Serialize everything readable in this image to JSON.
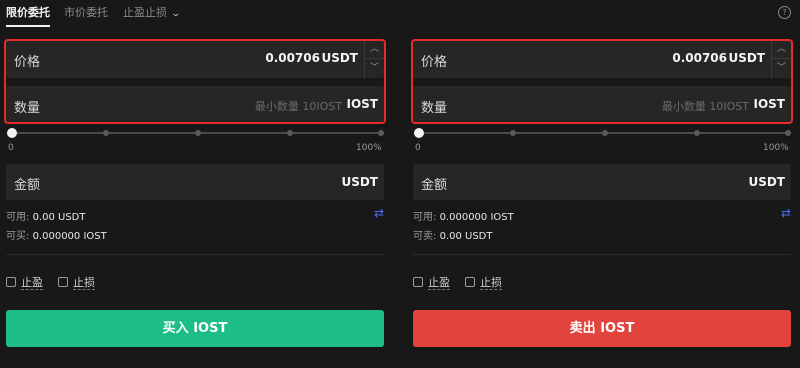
{
  "tabs": [
    {
      "label": "限价委托",
      "active": true
    },
    {
      "label": "市价委托",
      "active": false
    },
    {
      "label": "止盈止损",
      "active": false
    }
  ],
  "help_icon": "question-circle-icon",
  "colors": {
    "buy": "#1dbd8a",
    "sell": "#e0443d",
    "highlight": "#e42a2a",
    "swap": "#4a6cf5"
  },
  "buy": {
    "price_label": "价格",
    "price_value": "0.00706",
    "price_unit": "USDT",
    "qty_label": "数量",
    "qty_placeholder": "最小数量 10IOST",
    "qty_unit": "IOST",
    "slider_min": "0",
    "slider_max": "100%",
    "slider_value": 0,
    "amount_label": "金额",
    "amount_unit": "USDT",
    "available_label": "可用:",
    "available_value": "0.00 USDT",
    "can_label": "可买:",
    "can_value": "0.000000 IOST",
    "tp_label": "止盈",
    "sl_label": "止损",
    "action_label": "买入 IOST"
  },
  "sell": {
    "price_label": "价格",
    "price_value": "0.00706",
    "price_unit": "USDT",
    "qty_label": "数量",
    "qty_placeholder": "最小数量 10IOST",
    "qty_unit": "IOST",
    "slider_min": "0",
    "slider_max": "100%",
    "slider_value": 0,
    "amount_label": "金额",
    "amount_unit": "USDT",
    "available_label": "可用:",
    "available_value": "0.000000 IOST",
    "can_label": "可卖:",
    "can_value": "0.00 USDT",
    "tp_label": "止盈",
    "sl_label": "止损",
    "action_label": "卖出 IOST"
  }
}
